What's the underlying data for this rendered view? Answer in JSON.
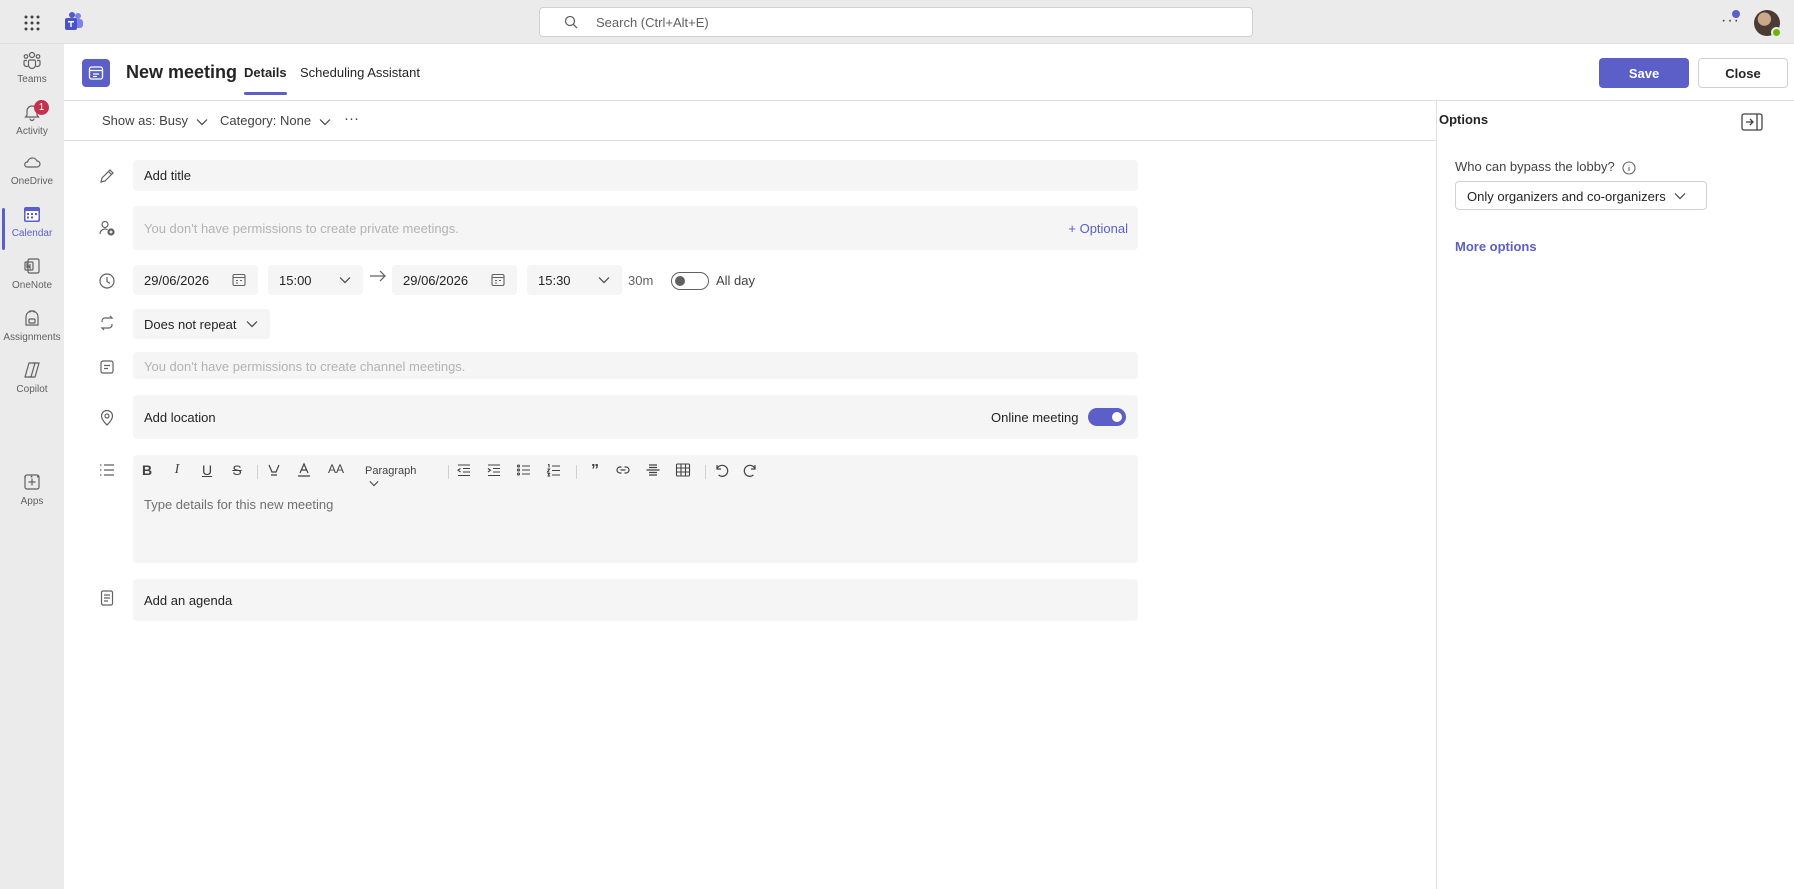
{
  "topbar": {
    "search_placeholder": "Search (Ctrl+Alt+E)",
    "more": "···"
  },
  "rail": {
    "items": [
      {
        "label": "Teams",
        "icon": "teams-icon"
      },
      {
        "label": "Activity",
        "icon": "bell-icon",
        "badge": "1"
      },
      {
        "label": "OneDrive",
        "icon": "cloud-icon"
      },
      {
        "label": "Calendar",
        "icon": "calendar-icon"
      },
      {
        "label": "OneNote",
        "icon": "onenote-icon"
      },
      {
        "label": "Assignments",
        "icon": "backpack-icon"
      },
      {
        "label": "Copilot",
        "icon": "copilot-icon"
      },
      {
        "label": "Apps",
        "icon": "add-app-icon"
      }
    ],
    "more": "···"
  },
  "header": {
    "title": "New meeting",
    "tabs": [
      {
        "label": "Details"
      },
      {
        "label": "Scheduling Assistant"
      }
    ],
    "save_label": "Save",
    "close_label": "Close"
  },
  "subbar": {
    "show_as": "Show as: Busy",
    "category": "Category: None",
    "more": "···"
  },
  "form": {
    "title_placeholder": "Add title",
    "attendees_placeholder": "You don't have permissions to create private meetings.",
    "optional_link": "+ Optional",
    "start_date": "29/06/2026",
    "start_time": "15:00",
    "end_date": "29/06/2026",
    "end_time": "15:30",
    "duration": "30m",
    "all_day_label": "All day",
    "all_day_on": false,
    "repeat": "Does not repeat",
    "channel_placeholder": "You don't have permissions to create channel meetings.",
    "location_placeholder": "Add location",
    "online_meeting_label": "Online meeting",
    "online_meeting_on": true,
    "editor": {
      "paragraph_label": "Paragraph",
      "placeholder": "Type details for this new meeting"
    },
    "agenda_placeholder": "Add an agenda"
  },
  "options_pane": {
    "title": "Options",
    "lobby_label": "Who can bypass the lobby?",
    "lobby_value": "Only organizers and co-organizers",
    "more_options": "More options"
  },
  "colors": {
    "accent": "#5b5fc7",
    "rail_bg": "#ebebeb",
    "field_bg": "#f5f5f5",
    "badge": "#c4314b",
    "presence": "#6bb700"
  }
}
